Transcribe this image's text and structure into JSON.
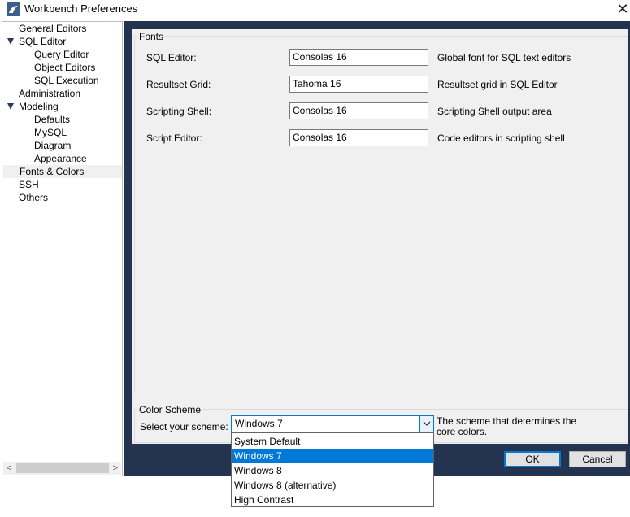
{
  "window": {
    "title": "Workbench Preferences",
    "close_glyph": "✕"
  },
  "sidebar": {
    "items": [
      {
        "label": "General Editors",
        "level": 0
      },
      {
        "label": "SQL Editor",
        "level": 0,
        "expanded": true
      },
      {
        "label": "Query Editor",
        "level": 1
      },
      {
        "label": "Object Editors",
        "level": 1
      },
      {
        "label": "SQL Execution",
        "level": 1
      },
      {
        "label": "Administration",
        "level": 0
      },
      {
        "label": "Modeling",
        "level": 0,
        "expanded": true
      },
      {
        "label": "Defaults",
        "level": 1
      },
      {
        "label": "MySQL",
        "level": 1
      },
      {
        "label": "Diagram",
        "level": 1
      },
      {
        "label": "Appearance",
        "level": 1
      },
      {
        "label": "Fonts & Colors",
        "level": 0,
        "selected": true
      },
      {
        "label": "SSH",
        "level": 0
      },
      {
        "label": "Others",
        "level": 0
      }
    ],
    "scroll_left": "<",
    "scroll_right": ">"
  },
  "fonts": {
    "group_title": "Fonts",
    "rows": [
      {
        "label": "SQL Editor:",
        "value": "Consolas 16",
        "desc": "Global font for SQL text editors"
      },
      {
        "label": "Resultset Grid:",
        "value": "Tahoma 16",
        "desc": "Resultset grid in SQL Editor"
      },
      {
        "label": "Scripting Shell:",
        "value": "Consolas 16",
        "desc": "Scripting Shell output area"
      },
      {
        "label": "Script Editor:",
        "value": "Consolas 16",
        "desc": "Code editors in scripting shell"
      }
    ]
  },
  "color_scheme": {
    "group_title": "Color Scheme",
    "label": "Select your scheme:",
    "selected": "Windows 7",
    "desc": "The scheme that determines the core colors.",
    "options": [
      "System Default",
      "Windows 7",
      "Windows 8",
      "Windows 8 (alternative)",
      "High Contrast"
    ],
    "highlighted_index": 1
  },
  "buttons": {
    "ok": "OK",
    "cancel": "Cancel"
  },
  "colors": {
    "accent": "#0078d7",
    "frame": "#233350",
    "pane": "#f0f0f0"
  }
}
